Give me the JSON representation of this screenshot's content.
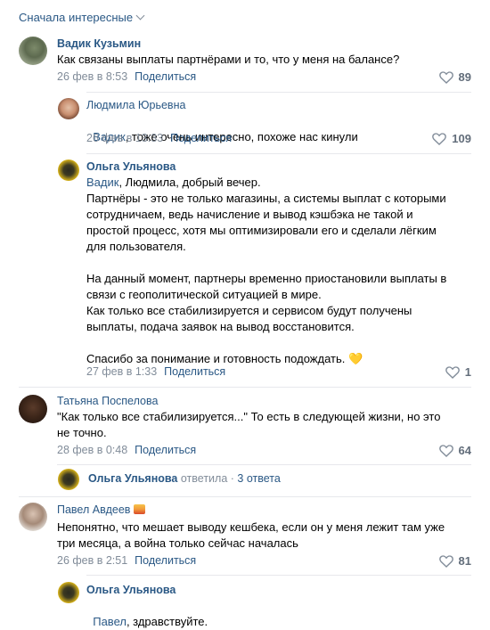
{
  "sort": {
    "label": "Сначала интересные"
  },
  "comments": [
    {
      "name": "Вадик Кузьмин",
      "text": "Как связаны выплаты партнёрами и то, что у меня на балансе?",
      "date": "26 фев в 8:53",
      "share": "Поделиться",
      "likes": "89"
    },
    {
      "name": "Людмила Юрьевна",
      "mention": "Вадик",
      "text": ", тоже очень интересно, похоже нас кинули",
      "date": "26 фев в 13:33",
      "share": "Поделиться",
      "likes": "109"
    },
    {
      "name": "Ольга Ульянова",
      "mention": "Вадик",
      "text": ", Людмила, добрый вечер.\nПартнёры - это не только магазины, а системы выплат с которыми\nсотрудничаем, ведь начисление и вывод кэшбэка не такой и\nпростой процесс, хотя мы оптимизировали его и сделали лёгким\nдля пользователя.\n\nНа данный момент, партнеры временно приостановили выплаты в\nсвязи с геополитической ситуацией в мире.\nКак только все стабилизируется и сервисом будут получены\nвыплаты, подача заявок на вывод восстановится.\n\nСпасибо за понимание и готовность подождать. 💛",
      "date": "27 фев в 1:33",
      "share": "Поделиться",
      "likes": "1"
    },
    {
      "name": "Татьяна Поспелова",
      "text": "\"Как только все стабилизируется...\" То есть в следующей жизни, но это\nне точно.",
      "date": "28 фев в 0:48",
      "share": "Поделиться",
      "likes": "64",
      "thread": {
        "name": "Ольга Ульянова",
        "action": "ответила",
        "sep": "·",
        "replies": "3 ответа"
      }
    },
    {
      "name": "Павел Авдеев",
      "text": "Непонятно, что мешает выводу кешбека, если он у меня лежит там уже\nтри месяца, а война только сейчас началась",
      "date": "26 фев в 2:51",
      "share": "Поделиться",
      "likes": "81"
    },
    {
      "name": "Ольга Ульянова",
      "mention": "Павел",
      "text": ", здравствуйте."
    }
  ]
}
